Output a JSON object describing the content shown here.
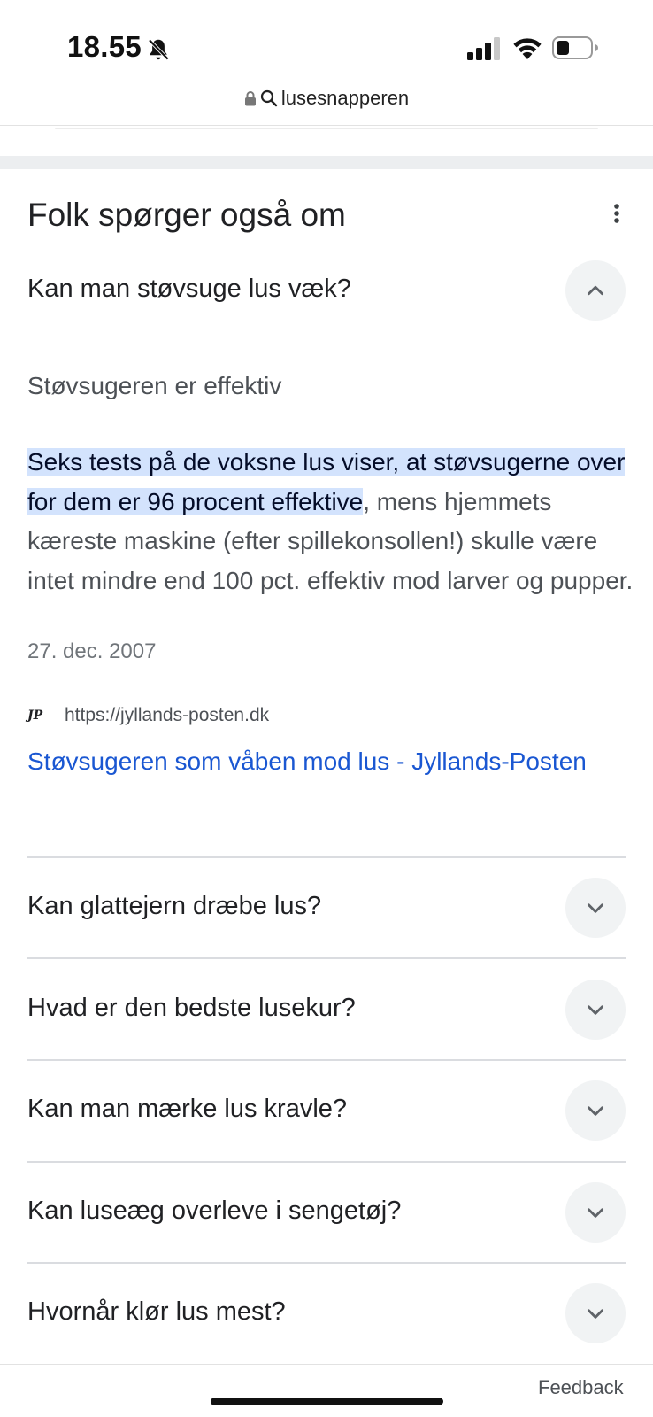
{
  "status_bar": {
    "time": "18.55",
    "icons": [
      "bell-slash-icon",
      "cellular-signal-icon",
      "wifi-icon",
      "battery-icon"
    ]
  },
  "browser": {
    "url_text": "lusesnapperen",
    "icons": [
      "lock-icon",
      "search-icon"
    ]
  },
  "people_also_ask": {
    "title": "Folk spørger også om",
    "menu_icon": "more-vert-icon",
    "questions": [
      {
        "question": "Kan man støvsuge lus væk?",
        "expanded": true,
        "answer": {
          "heading": "Støvsugeren er effektiv",
          "highlighted": " Seks tests på de voksne lus viser, at støvsugerne over for dem er 96 procent effektive",
          "rest": ", mens hjemmets kæreste maskine (efter spillekonsollen!) skulle være intet mindre end 100 pct. effektiv mod larver og pupper.",
          "date": "27. dec. 2007",
          "source_logo": "JP",
          "source_url": "https://jyllands-posten.dk",
          "link_title": "Støvsugeren som våben mod lus - Jyllands-Posten"
        }
      },
      {
        "question": "Kan glattejern dræbe lus?",
        "expanded": false
      },
      {
        "question": "Hvad er den bedste lusekur?",
        "expanded": false
      },
      {
        "question": "Kan man mærke lus kravle?",
        "expanded": false
      },
      {
        "question": "Kan luseæg overleve i sengetøj?",
        "expanded": false
      },
      {
        "question": "Hvornår klør lus mest?",
        "expanded": false
      }
    ]
  },
  "footer": {
    "feedback": "Feedback"
  },
  "colors": {
    "highlight": "#d3e3fd",
    "link": "#1a57d2",
    "chevron_bg": "#f1f3f4"
  }
}
